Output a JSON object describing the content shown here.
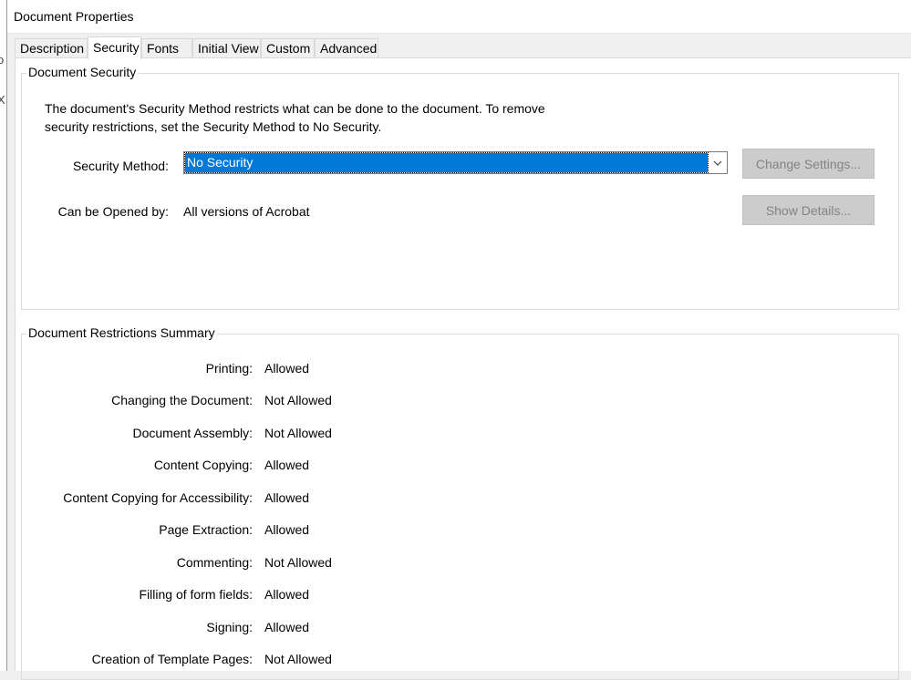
{
  "window": {
    "title": "Document Properties"
  },
  "left_edge_glyphs": [
    "o",
    "X"
  ],
  "tabs": [
    {
      "label": "Description",
      "active": false
    },
    {
      "label": "Security",
      "active": true
    },
    {
      "label": "Fonts",
      "active": false
    },
    {
      "label": "Initial View",
      "active": false
    },
    {
      "label": "Custom",
      "active": false
    },
    {
      "label": "Advanced",
      "active": false
    }
  ],
  "security": {
    "group_title": "Document Security",
    "description": "The document's Security Method restricts what can be done to the document. To remove security restrictions, set the Security Method to No Security.",
    "method_label": "Security Method:",
    "method_value": "No Security",
    "opened_by_label": "Can be Opened by:",
    "opened_by_value": "All versions of Acrobat",
    "change_settings_label": "Change Settings...",
    "show_details_label": "Show Details..."
  },
  "restrictions": {
    "group_title": "Document Restrictions Summary",
    "items": [
      {
        "label": "Printing:",
        "value": "Allowed"
      },
      {
        "label": "Changing the Document:",
        "value": "Not Allowed"
      },
      {
        "label": "Document Assembly:",
        "value": "Not Allowed"
      },
      {
        "label": "Content Copying:",
        "value": "Allowed"
      },
      {
        "label": "Content Copying for Accessibility:",
        "value": "Allowed"
      },
      {
        "label": "Page Extraction:",
        "value": "Allowed"
      },
      {
        "label": "Commenting:",
        "value": "Not Allowed"
      },
      {
        "label": "Filling of form fields:",
        "value": "Allowed"
      },
      {
        "label": "Signing:",
        "value": "Allowed"
      },
      {
        "label": "Creation of Template Pages:",
        "value": "Not Allowed"
      }
    ]
  },
  "colors": {
    "selection": "#0078d7",
    "disabled_button": "#cccccc",
    "disabled_text": "#838383"
  }
}
